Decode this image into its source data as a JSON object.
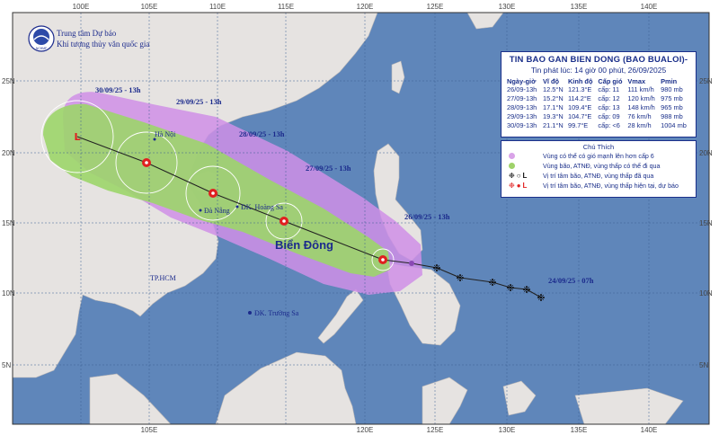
{
  "agency": {
    "line1": "Trung tâm Dự báo",
    "line2": "Khí tượng thủy văn quốc gia",
    "logo_caption": "NCHMF"
  },
  "bulletin": {
    "title": "TIN BAO GAN BIEN DONG (BAO BUALOI)-",
    "issued": "Tin phát lúc: 14 giờ 00 phút, 26/09/2025",
    "columns": [
      "Ngày-giờ",
      "Vĩ độ",
      "Kinh độ",
      "Cấp gió",
      "Vmax",
      "Pmin"
    ],
    "rows": [
      [
        "26/09-13h",
        "12.5°N",
        "121.3°E",
        "cấp: 11",
        "111 km/h",
        "980 mb"
      ],
      [
        "27/09-13h",
        "15.2°N",
        "114.2°E",
        "cấp: 12",
        "120 km/h",
        "975 mb"
      ],
      [
        "28/09-13h",
        "17.1°N",
        "109.4°E",
        "cấp: 13",
        "148 km/h",
        "965 mb"
      ],
      [
        "29/09-13h",
        "19.3°N",
        "104.7°E",
        "cấp: 09",
        "76 km/h",
        "988 mb"
      ],
      [
        "30/09-13h",
        "21.1°N",
        "99.7°E",
        "cấp: <6",
        "28 km/h",
        "1004 mb"
      ]
    ]
  },
  "legend": {
    "title": "Chú Thích",
    "items": [
      {
        "text": "Vùng có thể có gió mạnh lên hơn cấp 6",
        "symbol": "purple-dot-icon",
        "color": "#d9a3e8"
      },
      {
        "text": "Vùng bão, ATNĐ, vùng thấp có thể đi qua",
        "symbol": "green-dot-icon",
        "color": "#9fd26a"
      },
      {
        "text": "Vị trí tâm bão, ATNĐ, vùng thấp đã qua",
        "symbol": "black-storm-icons",
        "color": "#111111"
      },
      {
        "text": "Vị trí tâm bão, ATNĐ, vùng thấp hiện tại, dự báo",
        "symbol": "red-storm-icons",
        "color": "#e02020"
      }
    ]
  },
  "map": {
    "longitudes": [
      "100E",
      "105E",
      "110E",
      "115E",
      "120E",
      "125E",
      "130E",
      "135E",
      "140E"
    ],
    "latitudes": [
      "25N",
      "20N",
      "15N",
      "10N",
      "5N"
    ],
    "forecast_labels": [
      "30/09/25 - 13h",
      "29/09/25 - 13h",
      "28/09/25 - 13h",
      "27/09/25 - 13h",
      "26/09/25 - 13h",
      "24/09/25 - 07h"
    ],
    "places": {
      "hanoi": "Hà Nội",
      "danang": "Đà Nẵng",
      "hoangsa": "ĐK. Hoàng Sa",
      "truongsa": "ĐK. Trường Sa",
      "hcm": "TP.HCM",
      "sea": "Biển Đông"
    },
    "colors": {
      "sea": "#5f86ba",
      "land": "#e6e3e1",
      "purple": "#cf8fe6",
      "green": "#9cd56a",
      "track_red": "#e02020"
    }
  }
}
